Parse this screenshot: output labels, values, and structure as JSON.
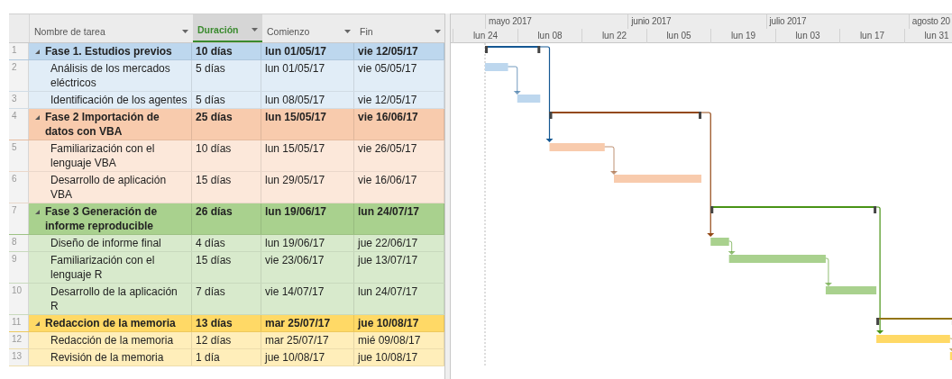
{
  "columns": [
    {
      "label": "Nombre de tarea",
      "selected": false
    },
    {
      "label": "Duración",
      "selected": true
    },
    {
      "label": "Comienzo",
      "selected": false
    },
    {
      "label": "Fin",
      "selected": false
    }
  ],
  "timescale": {
    "months": [
      "mayo 2017",
      "junio 2017",
      "julio 2017",
      "agosto 20"
    ],
    "weeks": [
      "lun 24",
      "lun 08",
      "lun 22",
      "lun 05",
      "lun 19",
      "lun 03",
      "lun 17",
      "lun 31"
    ]
  },
  "phases": [
    {
      "id": "1",
      "name": "Fase 1. Estudios previos",
      "duration": "10 días",
      "start": "lun 01/05/17",
      "end": "vie 12/05/17",
      "expanded": true,
      "color": "#bdd7ee",
      "tasks": [
        {
          "id": "2",
          "name": "Análisis de los mercados eléctricos",
          "duration": "5 días",
          "start": "lun 01/05/17",
          "end": "vie 05/05/17"
        },
        {
          "id": "3",
          "name": "Identificación de los agentes",
          "duration": "5 días",
          "start": "lun 08/05/17",
          "end": "vie 12/05/17"
        }
      ]
    },
    {
      "id": "4",
      "name": "Fase 2 Importación de datos con VBA",
      "duration": "25 días",
      "start": "lun 15/05/17",
      "end": "vie 16/06/17",
      "expanded": true,
      "color": "#f8cbad",
      "tasks": [
        {
          "id": "5",
          "name": "Familiarización con el lenguaje VBA",
          "duration": "10 días",
          "start": "lun 15/05/17",
          "end": "vie 26/05/17"
        },
        {
          "id": "6",
          "name": "Desarrollo de aplicación VBA",
          "duration": "15 días",
          "start": "lun 29/05/17",
          "end": "vie 16/06/17"
        }
      ]
    },
    {
      "id": "7",
      "name": "Fase 3 Generación de informe reproducible",
      "duration": "26 días",
      "start": "lun 19/06/17",
      "end": "lun 24/07/17",
      "expanded": true,
      "color": "#a9d18e",
      "tasks": [
        {
          "id": "8",
          "name": "Diseño de informe final",
          "duration": "4 días",
          "start": "lun 19/06/17",
          "end": "jue 22/06/17"
        },
        {
          "id": "9",
          "name": "Familiarización con el lenguaje R",
          "duration": "15 días",
          "start": "vie 23/06/17",
          "end": "jue 13/07/17"
        },
        {
          "id": "10",
          "name": "Desarrollo de la aplicación R",
          "duration": "7 días",
          "start": "vie 14/07/17",
          "end": "lun 24/07/17"
        }
      ]
    },
    {
      "id": "11",
      "name": "Redaccion de la memoria",
      "duration": "13 días",
      "start": "mar 25/07/17",
      "end": "jue 10/08/17",
      "expanded": true,
      "color": "#ffd966",
      "tasks": [
        {
          "id": "12",
          "name": "Redacción de la memoria",
          "duration": "12 días",
          "start": "mar 25/07/17",
          "end": "mié 09/08/17"
        },
        {
          "id": "13",
          "name": "Revisión de la memoria",
          "duration": "1 día",
          "start": "jue 10/08/17",
          "end": "jue 10/08/17"
        }
      ]
    }
  ]
}
